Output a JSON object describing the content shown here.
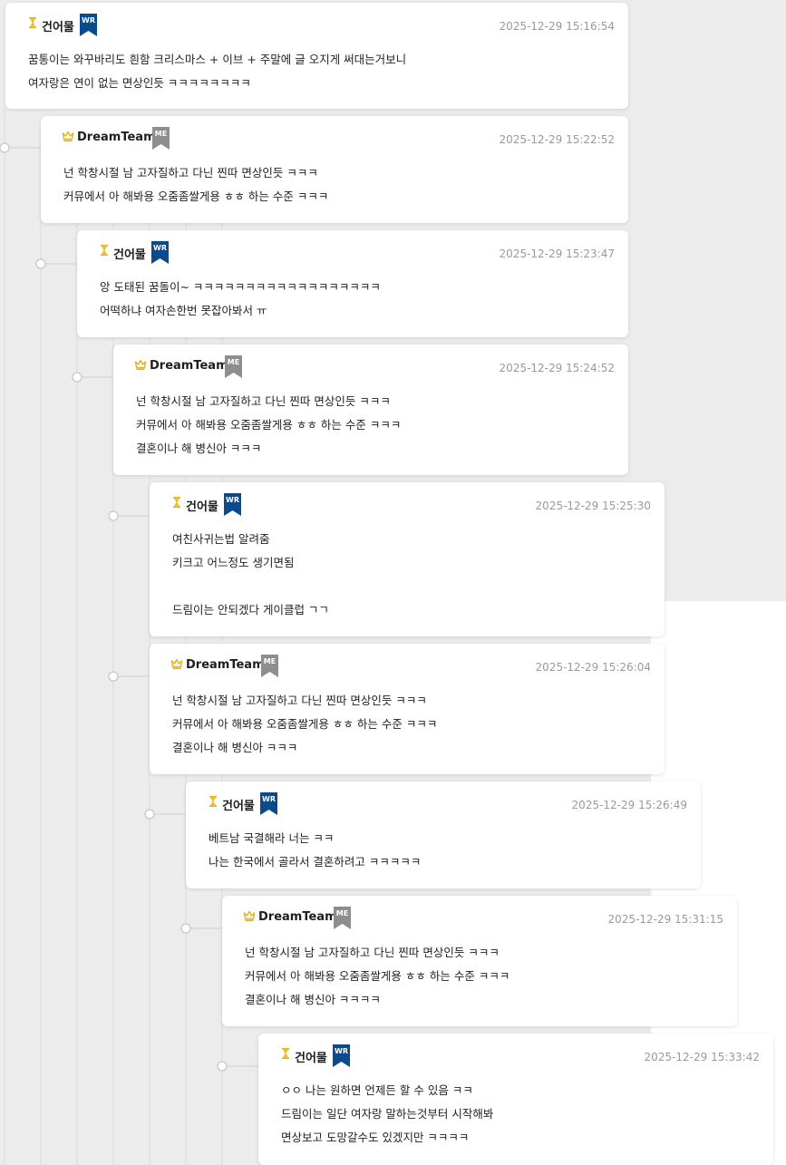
{
  "colors": {
    "writer_badge": "#0b4a8b",
    "me_badge": "#8e8e8e",
    "crown_gold": "#e7b417",
    "timestamp": "#9a9a9a",
    "background": "#ececec"
  },
  "badges": {
    "wr": "WR",
    "me": "ME"
  },
  "comments": [
    {
      "author": "건어물",
      "badge": "WR",
      "time": "2025-12-29 15:16:54",
      "lines": [
        "꿈통이는 와꾸바리도 흰함 크리스마스 + 이브 + 주말에 글 오지게 써대는거보니",
        "여자랑은 연이 없는 면상인듯 ㅋㅋㅋㅋㅋㅋㅋㅋ"
      ]
    },
    {
      "author": "DreamTeam",
      "badge": "ME",
      "time": "2025-12-29 15:22:52",
      "lines": [
        "넌 학창시절 남 고자질하고 다닌 찐따 면상인듯 ㅋㅋㅋ",
        "커뮤에서 아 해봐용 오줌좀쌀게용 ㅎㅎ 하는 수준 ㅋㅋㅋ"
      ]
    },
    {
      "author": "건어물",
      "badge": "WR",
      "time": "2025-12-29 15:23:47",
      "lines": [
        "앙 도태된 꿈돌이~ ㅋㅋㅋㅋㅋㅋㅋㅋㅋㅋㅋㅋㅋㅋㅋㅋㅋㅋ",
        "어떡하냐 여자손한번 못잡아봐서 ㅠ"
      ]
    },
    {
      "author": "DreamTeam",
      "badge": "ME",
      "time": "2025-12-29 15:24:52",
      "lines": [
        "넌 학창시절 남 고자질하고 다닌 찐따 면상인듯 ㅋㅋㅋ",
        "커뮤에서 아 해봐용 오줌좀쌀게용 ㅎㅎ 하는 수준 ㅋㅋㅋ",
        "결혼이나 해 병신아 ㅋㅋㅋ"
      ]
    },
    {
      "author": "건어물",
      "badge": "WR",
      "time": "2025-12-29 15:25:30",
      "lines": [
        "여친사귀는법 알려줌",
        "키크고 어느정도 생기면됨",
        "",
        "드림이는 안되겠다 게이클럽 ㄱㄱ"
      ]
    },
    {
      "author": "DreamTeam",
      "badge": "ME",
      "time": "2025-12-29 15:26:04",
      "lines": [
        "넌 학창시절 남 고자질하고 다닌 찐따 면상인듯 ㅋㅋㅋ",
        "커뮤에서 아 해봐용 오줌좀쌀게용 ㅎㅎ 하는 수준 ㅋㅋㅋ",
        "결혼이나 해 병신아 ㅋㅋㅋ"
      ]
    },
    {
      "author": "건어물",
      "badge": "WR",
      "time": "2025-12-29 15:26:49",
      "lines": [
        "베트남 국결해라 너는 ㅋㅋ",
        "나는 한국에서 골라서 결혼하려고 ㅋㅋㅋㅋㅋ"
      ]
    },
    {
      "author": "DreamTeam",
      "badge": "ME",
      "time": "2025-12-29 15:31:15",
      "lines": [
        "넌 학창시절 남 고자질하고 다닌 찐따 면상인듯 ㅋㅋㅋ",
        "커뮤에서 아 해봐용 오줌좀쌀게용 ㅎㅎ 하는 수준 ㅋㅋㅋ",
        "결혼이나 해 병신아 ㅋㅋㅋㅋ"
      ]
    },
    {
      "author": "건어물",
      "badge": "WR",
      "time": "2025-12-29 15:33:42",
      "lines": [
        "ㅇㅇ 나는 원하면 언제든 할 수 있음 ㅋㅋ",
        "드림이는 일단 여자랑 말하는것부터 시작해봐",
        "면상보고 도망갈수도 있겠지만 ㅋㅋㅋㅋ"
      ]
    }
  ]
}
